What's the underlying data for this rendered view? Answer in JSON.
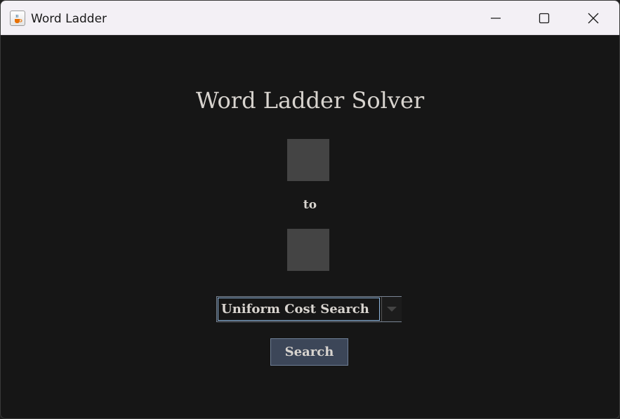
{
  "window": {
    "title": "Word Ladder",
    "icon": "java-cup-icon",
    "controls": [
      "minimize-icon",
      "maximize-icon",
      "close-icon"
    ]
  },
  "main": {
    "heading": "Word Ladder Solver",
    "start_word": "",
    "connector_label": "to",
    "end_word": "",
    "algorithm": {
      "selected": "Uniform Cost Search"
    },
    "search_label": "Search"
  },
  "colors": {
    "background": "#161616",
    "text": "#d8d4cf",
    "input_box": "#444444",
    "button": "#3c4658",
    "focus_border": "#8fb7e0"
  }
}
